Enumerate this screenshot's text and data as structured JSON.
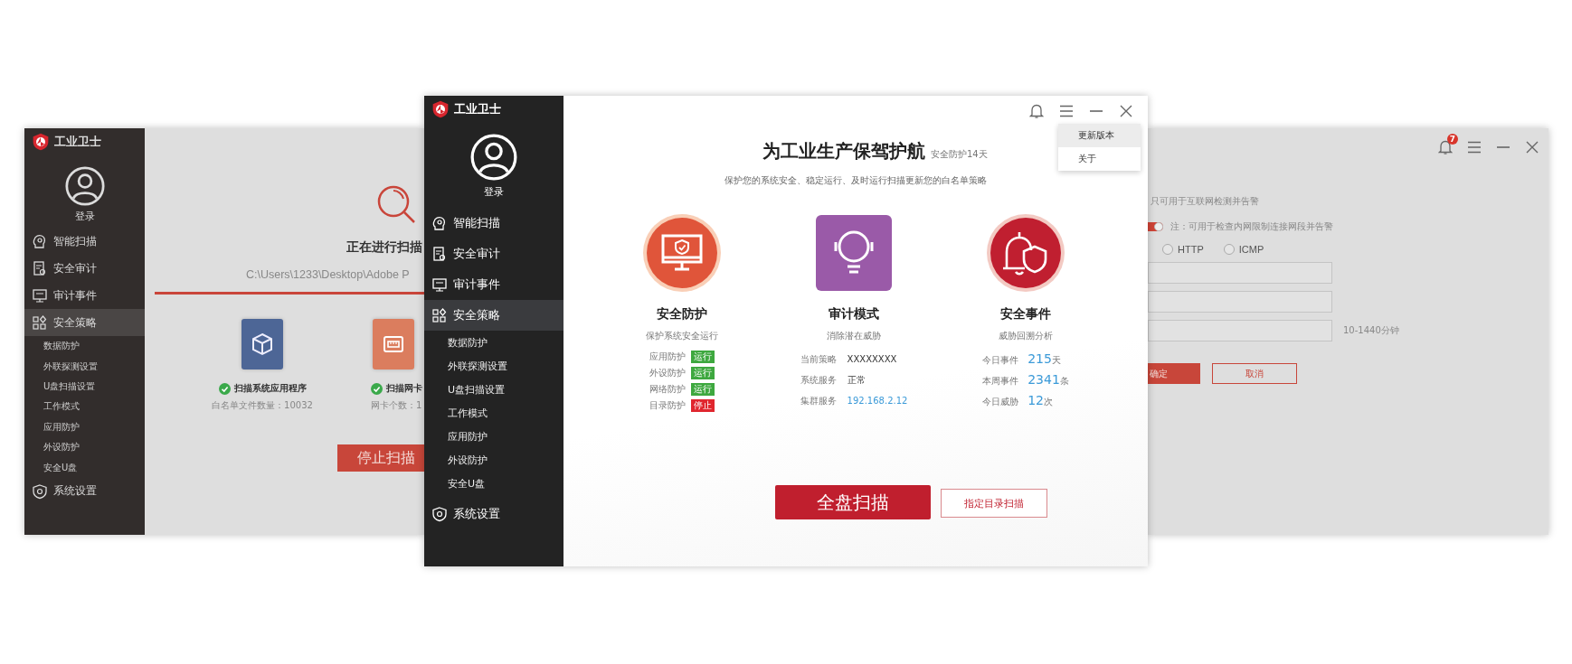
{
  "left_window": {
    "logo": "工业卫士",
    "login": "登录",
    "nav": [
      {
        "label": "智能扫描",
        "selected": false
      },
      {
        "label": "安全审计",
        "selected": false
      },
      {
        "label": "审计事件",
        "selected": false
      },
      {
        "label": "安全策略",
        "selected": true,
        "children": [
          {
            "label": "数据防护",
            "selected": false
          },
          {
            "label": "外联探测设置",
            "selected": false
          },
          {
            "label": "U盘扫描设置",
            "selected": false
          },
          {
            "label": "工作模式",
            "selected": false
          },
          {
            "label": "应用防护",
            "selected": false
          },
          {
            "label": "外设防护",
            "selected": false
          },
          {
            "label": "安全U盘",
            "selected": false
          }
        ]
      },
      {
        "label": "系统设置",
        "selected": false
      }
    ],
    "scan_title": "正在进行扫描",
    "scan_path": "C:\\Users\\1233\\Desktop\\Adobe P",
    "scan_items": [
      {
        "label": "扫描系统应用程序",
        "detail": "白名单文件数量：10032",
        "done": true
      },
      {
        "label": "扫描网卡",
        "detail": "网卡个数：1",
        "done": true
      }
    ],
    "stop_button": "停止扫描"
  },
  "main_window": {
    "logo": "工业卫士",
    "login": "登录",
    "nav": [
      {
        "label": "智能扫描",
        "selected": false
      },
      {
        "label": "安全审计",
        "selected": false
      },
      {
        "label": "审计事件",
        "selected": false
      },
      {
        "label": "安全策略",
        "selected": true,
        "children": [
          {
            "label": "数据防护",
            "selected": false
          },
          {
            "label": "外联探测设置",
            "selected": false
          },
          {
            "label": "U盘扫描设置",
            "selected": false
          },
          {
            "label": "工作模式",
            "selected": false
          },
          {
            "label": "应用防护",
            "selected": false
          },
          {
            "label": "外设防护",
            "selected": false
          },
          {
            "label": "安全U盘",
            "selected": false
          }
        ]
      },
      {
        "label": "系统设置",
        "selected": false
      }
    ],
    "menu": [
      {
        "label": "更新版本",
        "selected": true
      },
      {
        "label": "关于",
        "selected": false
      }
    ],
    "title": "为工业生产保驾护航",
    "badge": "安全防护14天",
    "subtitle": "保护您的系统安全、稳定运行、及时运行扫描更新您的白名单策略",
    "cards": [
      {
        "kind": "protection",
        "title": "安全防护",
        "subtitle": "保护系统安全运行",
        "rows": [
          {
            "label": "应用防护",
            "status": "运行",
            "on": true
          },
          {
            "label": "外设防护",
            "status": "运行",
            "on": true
          },
          {
            "label": "网络防护",
            "status": "运行",
            "on": true
          },
          {
            "label": "目录防护",
            "status": "停止",
            "on": false
          }
        ]
      },
      {
        "kind": "audit",
        "title": "审计模式",
        "subtitle": "消除潜在威胁",
        "rows": [
          {
            "label": "当前策略",
            "value": "XXXXXXXX",
            "kind": "text"
          },
          {
            "label": "系统服务",
            "value": "正常",
            "kind": "text"
          },
          {
            "label": "集群服务",
            "value": "192.168.2.12",
            "kind": "link"
          }
        ]
      },
      {
        "kind": "events",
        "title": "安全事件",
        "subtitle": "威胁回溯分析",
        "rows": [
          {
            "label": "今日事件",
            "count": "215",
            "unit": "天"
          },
          {
            "label": "本周事件",
            "count": "2341",
            "unit": "条"
          },
          {
            "label": "今日威胁",
            "count": "12",
            "unit": "次"
          }
        ]
      }
    ],
    "buttons": [
      {
        "label": "全盘扫描",
        "kind": "primary"
      },
      {
        "label": "指定目录扫描",
        "kind": "secondary"
      }
    ]
  },
  "right_window": {
    "notification_badge": "7",
    "note_1": "只可用于互联网检测并告警",
    "toggle_on": true,
    "note_2": "注：可用于检查内网限制连接网段并告警",
    "radios": [
      {
        "label": "HTTP",
        "selected": false
      },
      {
        "label": "ICMP",
        "selected": false
      }
    ],
    "fields": [
      {
        "kind": "text"
      },
      {
        "kind": "text"
      },
      {
        "kind": "text",
        "hint": "10-1440分钟"
      }
    ],
    "buttons": [
      {
        "label": "确定",
        "kind": "primary"
      },
      {
        "label": "取消",
        "kind": "secondary"
      }
    ]
  }
}
